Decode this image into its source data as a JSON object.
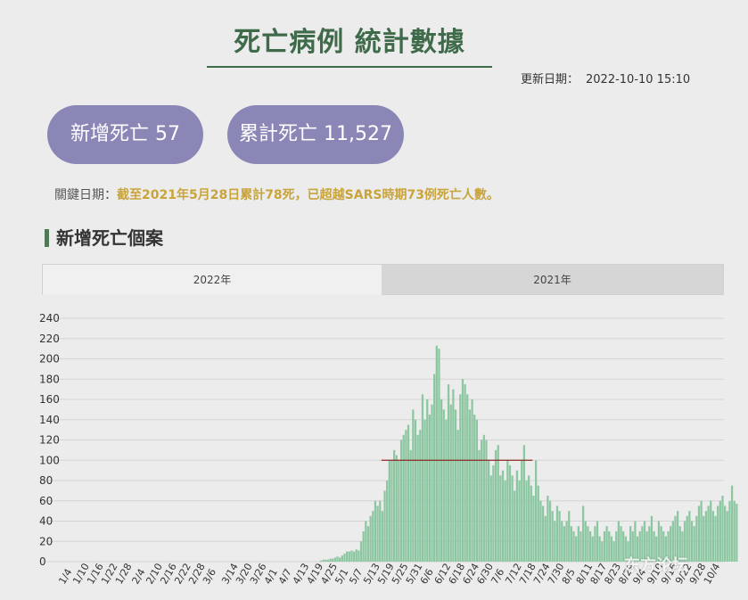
{
  "header": {
    "title": "死亡病例 統計數據",
    "updated_label": "更新日期：",
    "updated_value": "2022-10-10  15:10"
  },
  "stats": {
    "new_deaths": "新增死亡 57",
    "total_deaths": "累計死亡 11,527"
  },
  "key_date": {
    "label": "關鍵日期：",
    "text": "截至2021年5月28日累計78死，已超越SARS時期73例死亡人數。"
  },
  "section": {
    "title": "新增死亡個案"
  },
  "tabs": [
    "2022年",
    "2021年"
  ],
  "watermark": "东方论坛",
  "colors": {
    "bar": "#8cc7a1",
    "avg_line": "#8b2a2a",
    "pill": "#8a87b6",
    "accent": "#3f6b4a"
  },
  "chart_data": {
    "type": "bar",
    "title": "",
    "xlabel": "",
    "ylabel": "",
    "ylim": [
      0,
      240
    ],
    "yticks": [
      0,
      20,
      40,
      60,
      80,
      100,
      120,
      140,
      160,
      180,
      200,
      220,
      240
    ],
    "x_start": "2022-01-04",
    "x_end": "2022-10-10",
    "xticks": [
      "1/4",
      "1/10",
      "1/16",
      "1/22",
      "1/28",
      "2/4",
      "2/10",
      "2/16",
      "2/22",
      "2/28",
      "3/6",
      "3/14",
      "3/20",
      "3/26",
      "4/1",
      "4/7",
      "4/13",
      "4/19",
      "4/25",
      "5/1",
      "5/7",
      "5/13",
      "5/19",
      "5/25",
      "5/31",
      "6/6",
      "6/12",
      "6/18",
      "6/24",
      "6/30",
      "7/6",
      "7/12",
      "7/18",
      "7/24",
      "7/30",
      "8/5",
      "8/11",
      "8/17",
      "8/23",
      "8/29",
      "9/4",
      "9/10",
      "9/16",
      "9/22",
      "9/28",
      "10/4"
    ],
    "series": [
      {
        "name": "",
        "values": [
          0,
          0,
          0,
          0,
          0,
          0,
          0,
          0,
          0,
          0,
          0,
          0,
          0,
          0,
          0,
          0,
          0,
          0,
          0,
          0,
          0,
          0,
          0,
          0,
          0,
          0,
          0,
          0,
          0,
          0,
          0,
          0,
          0,
          0,
          0,
          0,
          0,
          0,
          0,
          0,
          0,
          0,
          0,
          0,
          0,
          0,
          0,
          0,
          0,
          0,
          0,
          0,
          0,
          0,
          0,
          0,
          0,
          0,
          0,
          0,
          0,
          0,
          0,
          0,
          0,
          0,
          0,
          0,
          0,
          0,
          0,
          0,
          0,
          0,
          0,
          0,
          0,
          0,
          0,
          0,
          0,
          0,
          0,
          0,
          0,
          0,
          0,
          0,
          0,
          0,
          0,
          0,
          0,
          0,
          0,
          0,
          0,
          0,
          0,
          0,
          0,
          0,
          0,
          0,
          0,
          0,
          0,
          0,
          0,
          1,
          2,
          2,
          2,
          3,
          3,
          4,
          5,
          4,
          6,
          8,
          10,
          10,
          11,
          10,
          12,
          11,
          20,
          30,
          40,
          35,
          45,
          50,
          60,
          55,
          60,
          50,
          70,
          80,
          100,
          100,
          110,
          105,
          100,
          120,
          125,
          130,
          135,
          110,
          150,
          140,
          125,
          130,
          165,
          140,
          160,
          145,
          155,
          185,
          213,
          210,
          160,
          150,
          140,
          175,
          155,
          170,
          150,
          130,
          165,
          180,
          175,
          165,
          150,
          160,
          145,
          140,
          110,
          120,
          125,
          120,
          100,
          85,
          95,
          110,
          115,
          85,
          90,
          80,
          100,
          95,
          85,
          70,
          90,
          80,
          100,
          115,
          80,
          85,
          75,
          65,
          100,
          75,
          60,
          55,
          45,
          65,
          60,
          50,
          40,
          55,
          50,
          40,
          35,
          40,
          50,
          35,
          30,
          25,
          35,
          30,
          55,
          40,
          35,
          30,
          25,
          35,
          40,
          25,
          20,
          30,
          35,
          30,
          25,
          20,
          30,
          40,
          35,
          30,
          25,
          20,
          35,
          30,
          40,
          25,
          30,
          35,
          40,
          30,
          35,
          45,
          30,
          25,
          40,
          35,
          30,
          25,
          30,
          35,
          40,
          45,
          50,
          35,
          30,
          40,
          45,
          50,
          40,
          35,
          45,
          55,
          60,
          45,
          50,
          55,
          60,
          50,
          45,
          55,
          60,
          65,
          55,
          50,
          60,
          75,
          60,
          57
        ]
      }
    ],
    "avg_line": {
      "value": 100,
      "from": "2022-05-19",
      "to": "2022-07-22"
    }
  }
}
